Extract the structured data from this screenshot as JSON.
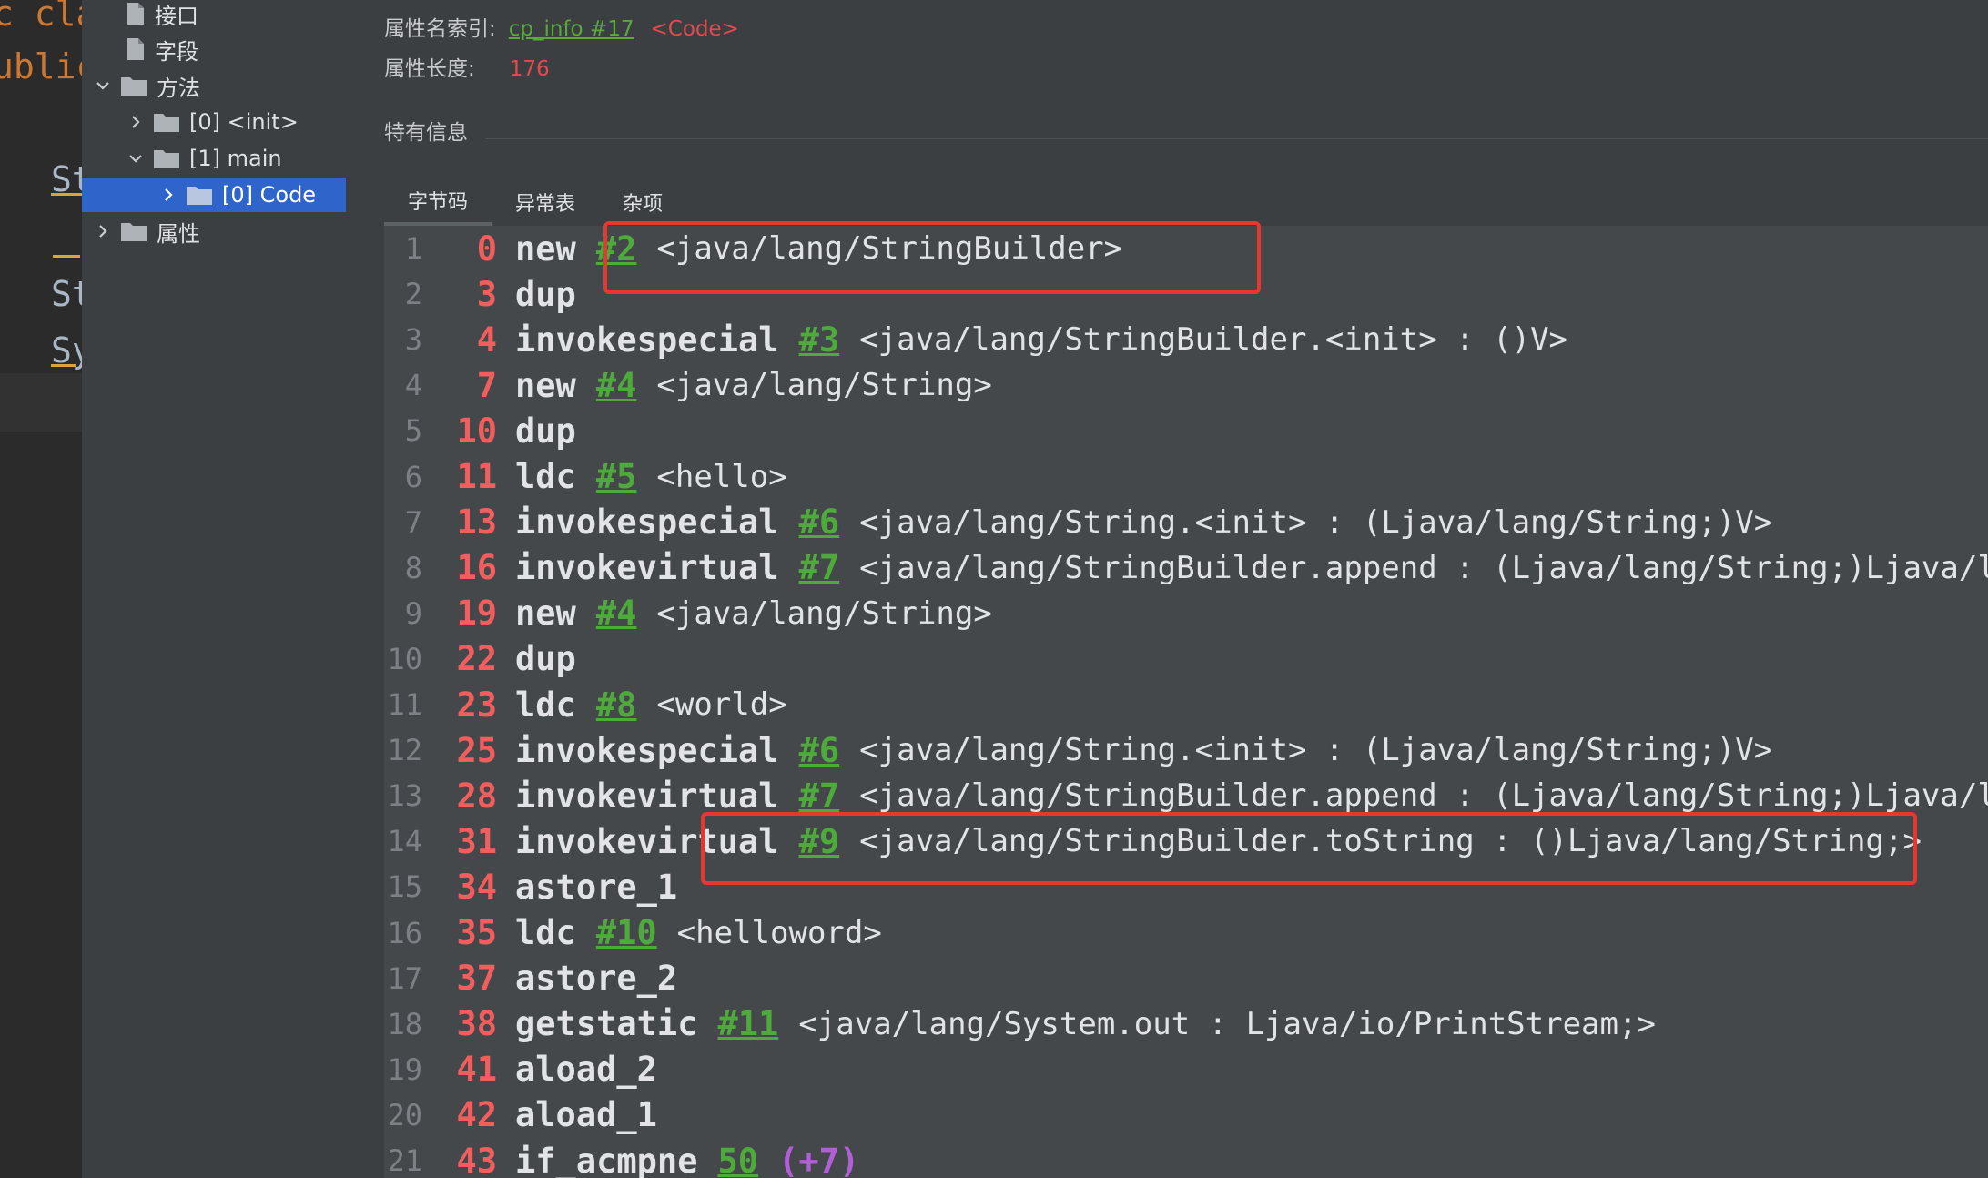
{
  "editor_fragments": {
    "line1": "c cla",
    "line2": "ublic",
    "line3": "St",
    "line4": "St",
    "line5": "Sy"
  },
  "tree": {
    "items": [
      {
        "label": "接口",
        "icon": "file-icon"
      },
      {
        "label": "字段",
        "icon": "file-icon"
      },
      {
        "label": "方法",
        "icon": "folder-icon",
        "expanded": true
      },
      {
        "label": "[0] <init>",
        "icon": "folder-icon",
        "expanded": false
      },
      {
        "label": "[1] main",
        "icon": "folder-icon",
        "expanded": true
      },
      {
        "label": "[0] Code",
        "icon": "folder-icon",
        "expanded": false,
        "selected": true
      },
      {
        "label": "属性",
        "icon": "folder-icon",
        "expanded": false
      }
    ]
  },
  "attribute": {
    "name_index_label": "属性名索引:",
    "name_index_link": "cp_info #17",
    "name_index_tag": "<Code>",
    "length_label": "属性长度:",
    "length_value": "176"
  },
  "section_title": "特有信息",
  "tabs": [
    {
      "label": "字节码",
      "active": true
    },
    {
      "label": "异常表",
      "active": false
    },
    {
      "label": "杂项",
      "active": false
    }
  ],
  "bytecode": [
    {
      "ln": "1",
      "off": "0",
      "op": "new",
      "ref": "#2",
      "desc": "<java/lang/StringBuilder>"
    },
    {
      "ln": "2",
      "off": "3",
      "op": "dup"
    },
    {
      "ln": "3",
      "off": "4",
      "op": "invokespecial",
      "ref": "#3",
      "desc": "<java/lang/StringBuilder.<init> : ()V>"
    },
    {
      "ln": "4",
      "off": "7",
      "op": "new",
      "ref": "#4",
      "desc": "<java/lang/String>"
    },
    {
      "ln": "5",
      "off": "10",
      "op": "dup"
    },
    {
      "ln": "6",
      "off": "11",
      "op": "ldc",
      "ref": "#5",
      "desc": "<hello>"
    },
    {
      "ln": "7",
      "off": "13",
      "op": "invokespecial",
      "ref": "#6",
      "desc": "<java/lang/String.<init> : (Ljava/lang/String;)V>"
    },
    {
      "ln": "8",
      "off": "16",
      "op": "invokevirtual",
      "ref": "#7",
      "desc": "<java/lang/StringBuilder.append : (Ljava/lang/String;)Ljava/lan"
    },
    {
      "ln": "9",
      "off": "19",
      "op": "new",
      "ref": "#4",
      "desc": "<java/lang/String>"
    },
    {
      "ln": "10",
      "off": "22",
      "op": "dup"
    },
    {
      "ln": "11",
      "off": "23",
      "op": "ldc",
      "ref": "#8",
      "desc": "<world>"
    },
    {
      "ln": "12",
      "off": "25",
      "op": "invokespecial",
      "ref": "#6",
      "desc": "<java/lang/String.<init> : (Ljava/lang/String;)V>"
    },
    {
      "ln": "13",
      "off": "28",
      "op": "invokevirtual",
      "ref": "#7",
      "desc": "<java/lang/StringBuilder.append : (Ljava/lang/String;)Ljava/lan"
    },
    {
      "ln": "14",
      "off": "31",
      "op": "invokevirtual",
      "ref": "#9",
      "desc": "<java/lang/StringBuilder.toString : ()Ljava/lang/String;>"
    },
    {
      "ln": "15",
      "off": "34",
      "op": "astore_1"
    },
    {
      "ln": "16",
      "off": "35",
      "op": "ldc",
      "ref": "#10",
      "desc": "<helloword>"
    },
    {
      "ln": "17",
      "off": "37",
      "op": "astore_2"
    },
    {
      "ln": "18",
      "off": "38",
      "op": "getstatic",
      "ref": "#11",
      "desc": "<java/lang/System.out : Ljava/io/PrintStream;>"
    },
    {
      "ln": "19",
      "off": "41",
      "op": "aload_2"
    },
    {
      "ln": "20",
      "off": "42",
      "op": "aload_1"
    },
    {
      "ln": "21",
      "off": "43",
      "op": "if_acmpne",
      "ref": "50",
      "rel": "(+7)"
    }
  ],
  "colors": {
    "highlight": "#e5382f",
    "offset": "#f25e5e",
    "reference": "#4faa3c",
    "selection": "#2f65ca"
  }
}
